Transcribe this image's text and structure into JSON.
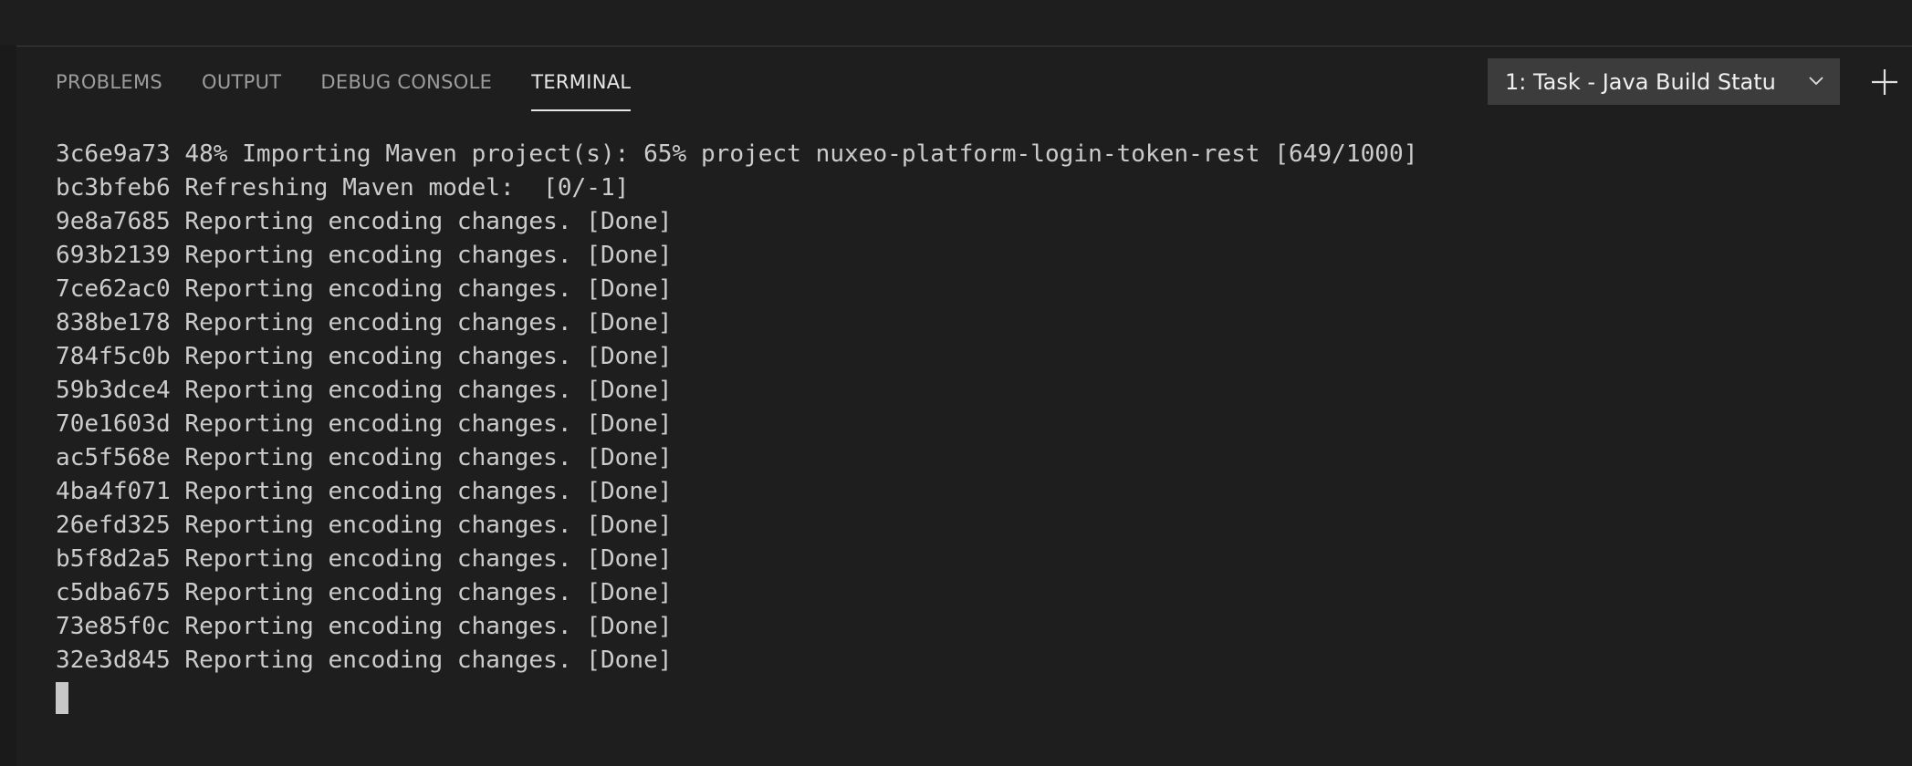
{
  "panel": {
    "tabs": [
      {
        "label": "PROBLEMS"
      },
      {
        "label": "OUTPUT"
      },
      {
        "label": "DEBUG CONSOLE"
      },
      {
        "label": "TERMINAL"
      }
    ],
    "active_tab": "TERMINAL",
    "task_selector": {
      "label": "1: Task - Java Build Statu",
      "icon": "chevron-down-icon"
    },
    "new_terminal_icon": "plus-icon"
  },
  "terminal": {
    "lines": [
      "3c6e9a73 48% Importing Maven project(s): 65% project nuxeo-platform-login-token-rest [649/1000]",
      "bc3bfeb6 Refreshing Maven model:  [0/-1]",
      "9e8a7685 Reporting encoding changes. [Done]",
      "693b2139 Reporting encoding changes. [Done]",
      "7ce62ac0 Reporting encoding changes. [Done]",
      "838be178 Reporting encoding changes. [Done]",
      "784f5c0b Reporting encoding changes. [Done]",
      "59b3dce4 Reporting encoding changes. [Done]",
      "70e1603d Reporting encoding changes. [Done]",
      "ac5f568e Reporting encoding changes. [Done]",
      "4ba4f071 Reporting encoding changes. [Done]",
      "26efd325 Reporting encoding changes. [Done]",
      "b5f8d2a5 Reporting encoding changes. [Done]",
      "c5dba675 Reporting encoding changes. [Done]",
      "73e85f0c Reporting encoding changes. [Done]",
      "32e3d845 Reporting encoding changes. [Done]"
    ]
  },
  "colors": {
    "background": "#1e1e1e",
    "tab_inactive": "#9d9d9d",
    "tab_active": "#e7e7e7",
    "dropdown_bg": "#3c3c3c",
    "terminal_text": "#cccccc"
  }
}
